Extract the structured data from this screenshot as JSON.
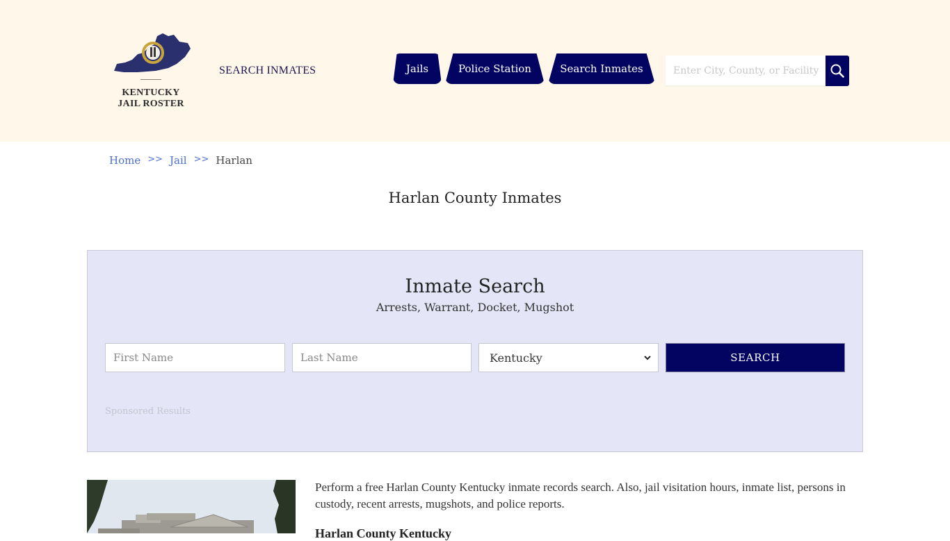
{
  "header": {
    "logo_text_line1": "KENTUCKY",
    "logo_text_line2": "JAIL ROSTER",
    "search_inmates_link": "SEARCH INMATES",
    "nav": [
      {
        "label": "Jails"
      },
      {
        "label": "Police Station"
      },
      {
        "label": "Search Inmates"
      }
    ],
    "search": {
      "placeholder": "Enter City, County, or Facility",
      "value": "",
      "button_icon": "search-icon"
    }
  },
  "breadcrumb": {
    "items": [
      {
        "label": "Home"
      },
      {
        "label": "Jail"
      },
      {
        "label": "Harlan"
      }
    ],
    "separator": ">>"
  },
  "page_title": "Harlan County Inmates",
  "inmate_search": {
    "title": "Inmate Search",
    "subtitle": "Arrests, Warrant, Docket, Mugshot",
    "first_name_placeholder": "First Name",
    "last_name_placeholder": "Last Name",
    "state_selected": "Kentucky",
    "search_button": "SEARCH",
    "sponsored_label": "Sponsored Results"
  },
  "content": {
    "intro": "Perform a free Harlan County Kentucky inmate records search. Also, jail visitation hours, inmate list, persons in custody, recent arrests, mugshots, and police reports.",
    "sub_heading": "Harlan County Kentucky"
  },
  "colors": {
    "header_bg": "#fff8ea",
    "brand_navy": "#030362",
    "panel_bg": "#e4e6f7",
    "link_blue": "#4a6fd0"
  }
}
